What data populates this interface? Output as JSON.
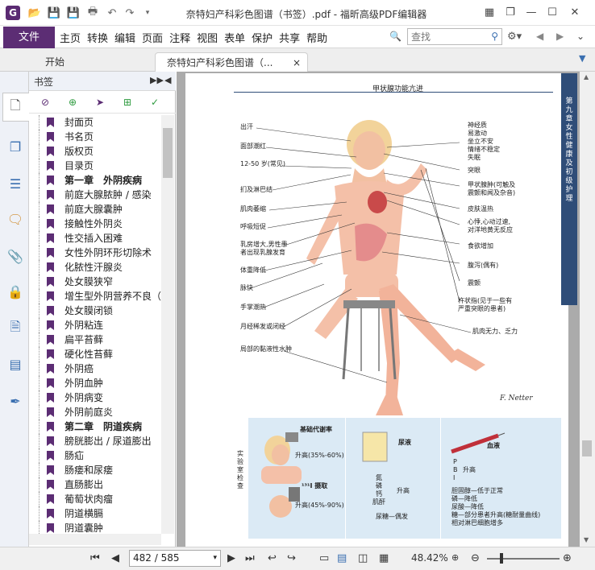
{
  "window": {
    "title": "奈特妇产科彩色图谱（书签）.pdf - 福昕高级PDF编辑器",
    "colors": {
      "accent": "#5c2d74",
      "rail": "#eef1f7",
      "page_bg": "#ababab",
      "strip": "#2f4d78"
    }
  },
  "titlebar": {
    "app_icon": "foxit-logo",
    "app_icon_letter": "G",
    "quick_access": [
      "open-folder-icon",
      "save-icon",
      "save-as-icon",
      "print-icon",
      "undo-icon",
      "redo-icon",
      "dropdown-icon"
    ]
  },
  "menu": {
    "file_label": "文件",
    "items": [
      "主页",
      "转换",
      "编辑",
      "页面",
      "注释",
      "视图",
      "表单",
      "保护",
      "共享",
      "帮助"
    ],
    "search_placeholder": "查找"
  },
  "tabs": [
    {
      "label": "开始"
    },
    {
      "label": "奈特妇产科彩色图谱（...",
      "close": "×"
    }
  ],
  "bookmarks": {
    "title": "书签",
    "items": [
      {
        "label": "封面页",
        "bold": false
      },
      {
        "label": "书名页",
        "bold": false
      },
      {
        "label": "版权页",
        "bold": false
      },
      {
        "label": "目录页",
        "bold": false
      },
      {
        "label": "第一章　外阴疾病",
        "bold": true
      },
      {
        "label": "前庭大腺脓肿 / 感染",
        "bold": false
      },
      {
        "label": "前庭大腺囊肿",
        "bold": false
      },
      {
        "label": "接触性外阴炎",
        "bold": false
      },
      {
        "label": "性交插入困难",
        "bold": false
      },
      {
        "label": "女性外阴环形切除术",
        "bold": false
      },
      {
        "label": "化脓性汗腺炎",
        "bold": false
      },
      {
        "label": "处女膜狭窄",
        "bold": false
      },
      {
        "label": "增生型外阴营养不良（",
        "bold": false
      },
      {
        "label": "处女膜闭锁",
        "bold": false
      },
      {
        "label": "外阴粘连",
        "bold": false
      },
      {
        "label": "扁平苔藓",
        "bold": false
      },
      {
        "label": "硬化性苔藓",
        "bold": false
      },
      {
        "label": "外阴癌",
        "bold": false
      },
      {
        "label": "外阴血肿",
        "bold": false
      },
      {
        "label": "外阴病变",
        "bold": false
      },
      {
        "label": "外阴前庭炎",
        "bold": false
      },
      {
        "label": "第二章　阴道疾病",
        "bold": true
      },
      {
        "label": "膀胱膨出 / 尿道膨出",
        "bold": false
      },
      {
        "label": "肠疝",
        "bold": false
      },
      {
        "label": "肠瘘和尿瘘",
        "bold": false
      },
      {
        "label": "直肠膨出",
        "bold": false
      },
      {
        "label": "葡萄状肉瘤",
        "bold": false
      },
      {
        "label": "阴道横膈",
        "bold": false
      },
      {
        "label": "阴道囊肿",
        "bold": false
      }
    ]
  },
  "page": {
    "header": "甲状腺功能亢进",
    "chapter_strip": "第九章　女性健康及初级护理",
    "labels_left": [
      "出汗",
      "面部潮红",
      "12-50 岁(常见)",
      "扪及淋巴结",
      "肌肉萎缩",
      "呼吸短促",
      "乳房增大,男性患",
      "者出现乳腺发育",
      "体重降低",
      "脉快",
      "手掌潮热",
      "月经稀发或闭经",
      "局部的黏液性水肿"
    ],
    "labels_right": [
      "神经质",
      "易激动",
      "坐立不安",
      "情绪不稳定",
      "失眠",
      "突眼",
      "甲状腺肿(可触及",
      "震颤和闻及杂音)",
      "皮肤温热",
      "心悸,心动过速,",
      "对洋地黄无反应",
      "食欲增加",
      "腹泻(偶有)",
      "震颤",
      "杵状指(见于一些有",
      "严重突眼的患者)",
      "肌肉无力、乏力"
    ],
    "bottom": {
      "side_label": "实验室检查",
      "box1_title": "基础代谢率",
      "box1_value": "升高(35%-60%)",
      "box2_title": "¹³¹I 摄取",
      "box2_value": "升高(45%-90%)",
      "urine_title": "尿液",
      "urine_items": [
        "氮",
        "磷",
        "钙",
        "肌酐"
      ],
      "urine_result": "升高",
      "urine_note": "尿糖—偶发",
      "blood_title": "血液",
      "blood_items": [
        "P",
        "B",
        "I"
      ],
      "blood_result": "升高",
      "blood_notes": [
        "胆固醇—低于正常",
        "磷—降低",
        "尿酸—降低",
        "糖—部分患者升高(糖耐量曲线)",
        "相对淋巴细胞增多"
      ]
    }
  },
  "status": {
    "page_indicator": "482 / 585",
    "zoom": "48.42%"
  }
}
